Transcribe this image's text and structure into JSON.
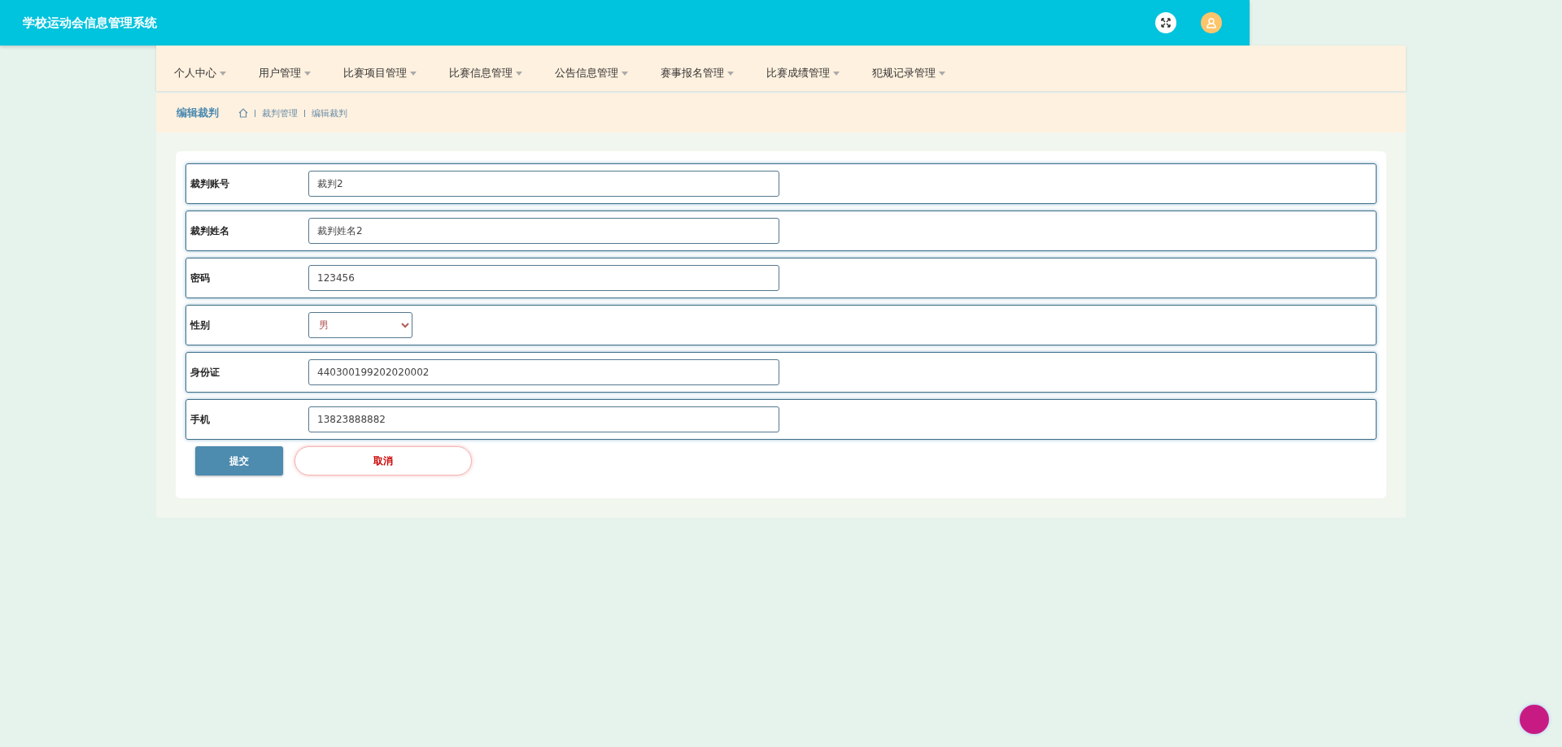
{
  "header": {
    "title": "学校运动会信息管理系统"
  },
  "nav": [
    {
      "label": "个人中心"
    },
    {
      "label": "用户管理"
    },
    {
      "label": "比赛项目管理"
    },
    {
      "label": "比赛信息管理"
    },
    {
      "label": "公告信息管理"
    },
    {
      "label": "赛事报名管理"
    },
    {
      "label": "比赛成绩管理"
    },
    {
      "label": "犯规记录管理"
    }
  ],
  "page_title": "编辑裁判",
  "breadcrumb": [
    "裁判管理",
    "编辑裁判"
  ],
  "fields": [
    {
      "label": "裁判账号",
      "kind": "text",
      "value": "裁判2"
    },
    {
      "label": "裁判姓名",
      "kind": "text",
      "value": "裁判姓名2"
    },
    {
      "label": "密码",
      "kind": "text",
      "value": "123456"
    },
    {
      "label": "性别",
      "kind": "select",
      "value": "男"
    },
    {
      "label": "身份证",
      "kind": "text",
      "value": "440300199202020002"
    },
    {
      "label": "手机",
      "kind": "text",
      "value": "13823888882"
    }
  ],
  "buttons": [
    {
      "label": "提交",
      "kind": "primary"
    },
    {
      "label": "取消",
      "kind": "secondary"
    }
  ]
}
